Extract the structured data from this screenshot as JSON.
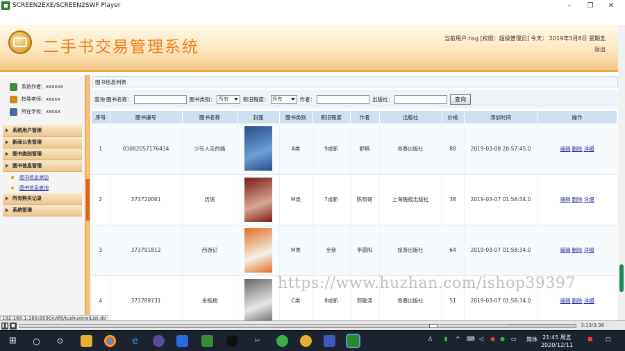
{
  "window": {
    "title": "SCREEN2EXE/SCREEN2SWF Player",
    "minimize": "–",
    "maximize": "❐",
    "close": "✕"
  },
  "header": {
    "title": "二手书交易管理系统",
    "userinfo": "当前用户:hsg [权限：超级管理员] 今天： 2019年3月8日 星期五",
    "logout": "退出"
  },
  "sidebar": {
    "info": [
      {
        "label": "系统作者：xxxxxx",
        "icon": "user-icon",
        "color": "#3a8a3a"
      },
      {
        "label": "指导老师：xxxxx",
        "icon": "teacher-icon",
        "color": "#d28a1a"
      },
      {
        "label": "所在学校：xxxxx",
        "icon": "school-icon",
        "color": "#4a6aa0"
      }
    ],
    "menu": [
      {
        "type": "item",
        "label": "系统用户管理"
      },
      {
        "type": "item",
        "label": "新闻公告管理"
      },
      {
        "type": "item",
        "label": "图书类别管理"
      },
      {
        "type": "item",
        "label": "图书信息管理"
      },
      {
        "type": "sub",
        "label": "图书信息添加"
      },
      {
        "type": "sub",
        "label": "图书信息查询"
      },
      {
        "type": "item",
        "label": "所有购买记录"
      },
      {
        "type": "item",
        "label": "系统管理"
      }
    ]
  },
  "main": {
    "panel_title": "图书信息列表",
    "search": {
      "prefix": "查询",
      "name_label": "图书名称：",
      "category_label": "图书类别：",
      "category_value": "所有",
      "condition_label": "新旧程度：",
      "condition_value": "所有",
      "author_label": "作者：",
      "publisher_label": "出版社：",
      "button": "查询"
    },
    "columns": [
      "序号",
      "图书编号",
      "图书名称",
      "封面",
      "图书类别",
      "新旧程度",
      "作者",
      "出版社",
      "价格",
      "添加时间",
      "操作"
    ],
    "rows": [
      {
        "index": "1",
        "code": "03082057176434",
        "name": "少有人走的路",
        "category": "A类",
        "condition": "9成新",
        "author": "舒畅",
        "publisher": "青春出版社",
        "price": "88",
        "time": "2019-03-08 20:57:45.0",
        "cover_colors": [
          "#2a4a8a",
          "#6aa0d8"
        ]
      },
      {
        "index": "2",
        "code": "373720061",
        "name": "历练",
        "category": "M类",
        "condition": "7成新",
        "author": "陈明哥",
        "publisher": "上海晚报出版社",
        "price": "38",
        "time": "2019-03-07 01:58:34.0",
        "cover_colors": [
          "#7a1a1a",
          "#d8a890"
        ]
      },
      {
        "index": "3",
        "code": "373791812",
        "name": "西游记",
        "category": "M类",
        "condition": "全新",
        "author": "李晨阳",
        "publisher": "旅游出版社",
        "price": "64",
        "time": "2019-03-07 01:58:34.0",
        "cover_colors": [
          "#e07020",
          "#f4f0e8"
        ]
      },
      {
        "index": "4",
        "code": "373789731",
        "name": "金瓶梅",
        "category": "C类",
        "condition": "8成新",
        "author": "郭敬涛",
        "publisher": "青春出版社",
        "price": "51",
        "time": "2019-03-07 01:58:34.0",
        "cover_colors": [
          "#666666",
          "#e8e8e8"
        ]
      }
    ],
    "ops": {
      "edit": "编辑",
      "delete": "删除",
      "detail": "详细"
    }
  },
  "status_url": "192.168.1.168:8090/utf8/tushuxinxiList.do",
  "watermark": "https://www.huzhan.com/ishop39397",
  "player": {
    "time": "3:13/3:38",
    "progress": 0.876
  },
  "taskbar": {
    "ime": "简体",
    "clock_time": "21:45 周五",
    "clock_date": "2020/12/11"
  }
}
